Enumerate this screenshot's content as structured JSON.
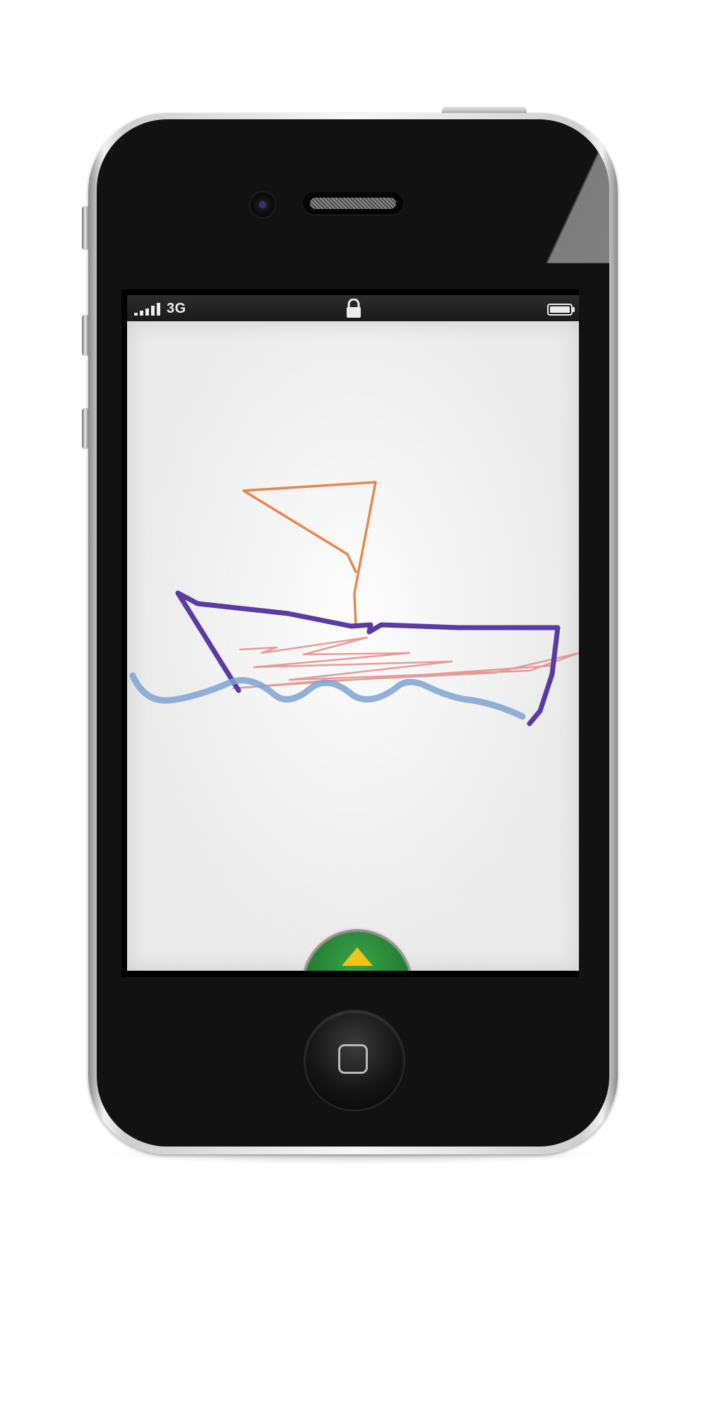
{
  "status_bar": {
    "signal_bars": 5,
    "network": "3G",
    "lock_icon": "lock-icon",
    "battery_icon": "battery-icon"
  },
  "drawing_canvas": {
    "strokes": [
      {
        "name": "sail",
        "color": "#e37b3d"
      },
      {
        "name": "hull",
        "color": "#5a3aa3"
      },
      {
        "name": "deck-scribble",
        "color": "#e38a8a"
      },
      {
        "name": "waves",
        "color": "#7fa3cf"
      }
    ]
  },
  "controls": {
    "expand_button_icon": "up-arrow-icon",
    "expand_button_color": "#1f7a2f",
    "expand_arrow_color": "#f2c418",
    "home_button_icon": "home-square-icon"
  }
}
